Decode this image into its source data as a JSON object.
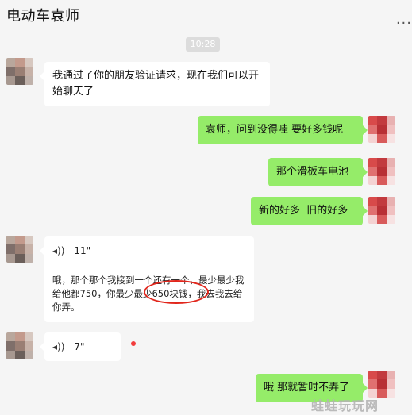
{
  "header": {
    "title": "电动车袁师",
    "more_label": "..."
  },
  "timestamp": "10:28",
  "messages": [
    {
      "side": "left",
      "text": "我通过了你的朋友验证请求，现在我们可以开始聊天了"
    },
    {
      "side": "right",
      "text": "袁师，问到没得哇 要好多钱呢"
    },
    {
      "side": "right",
      "text": "那个滑板车电池"
    },
    {
      "side": "right",
      "text": "新的好多  旧的好多"
    },
    {
      "side": "left",
      "type": "voice",
      "duration": "11\"",
      "transcript": "哦，那个那个我接到一个还有一个，最少最少我给他都750，你最少最少650块钱，我去我去给你弄。"
    },
    {
      "side": "left",
      "type": "voice",
      "duration": "7\"",
      "unread": true
    },
    {
      "side": "right",
      "text": "哦 那就暂时不弄了"
    }
  ],
  "icons": {
    "voice": "voice-wave-icon",
    "more": "more-icon"
  },
  "watermark": "蛙蛙玩玩网"
}
